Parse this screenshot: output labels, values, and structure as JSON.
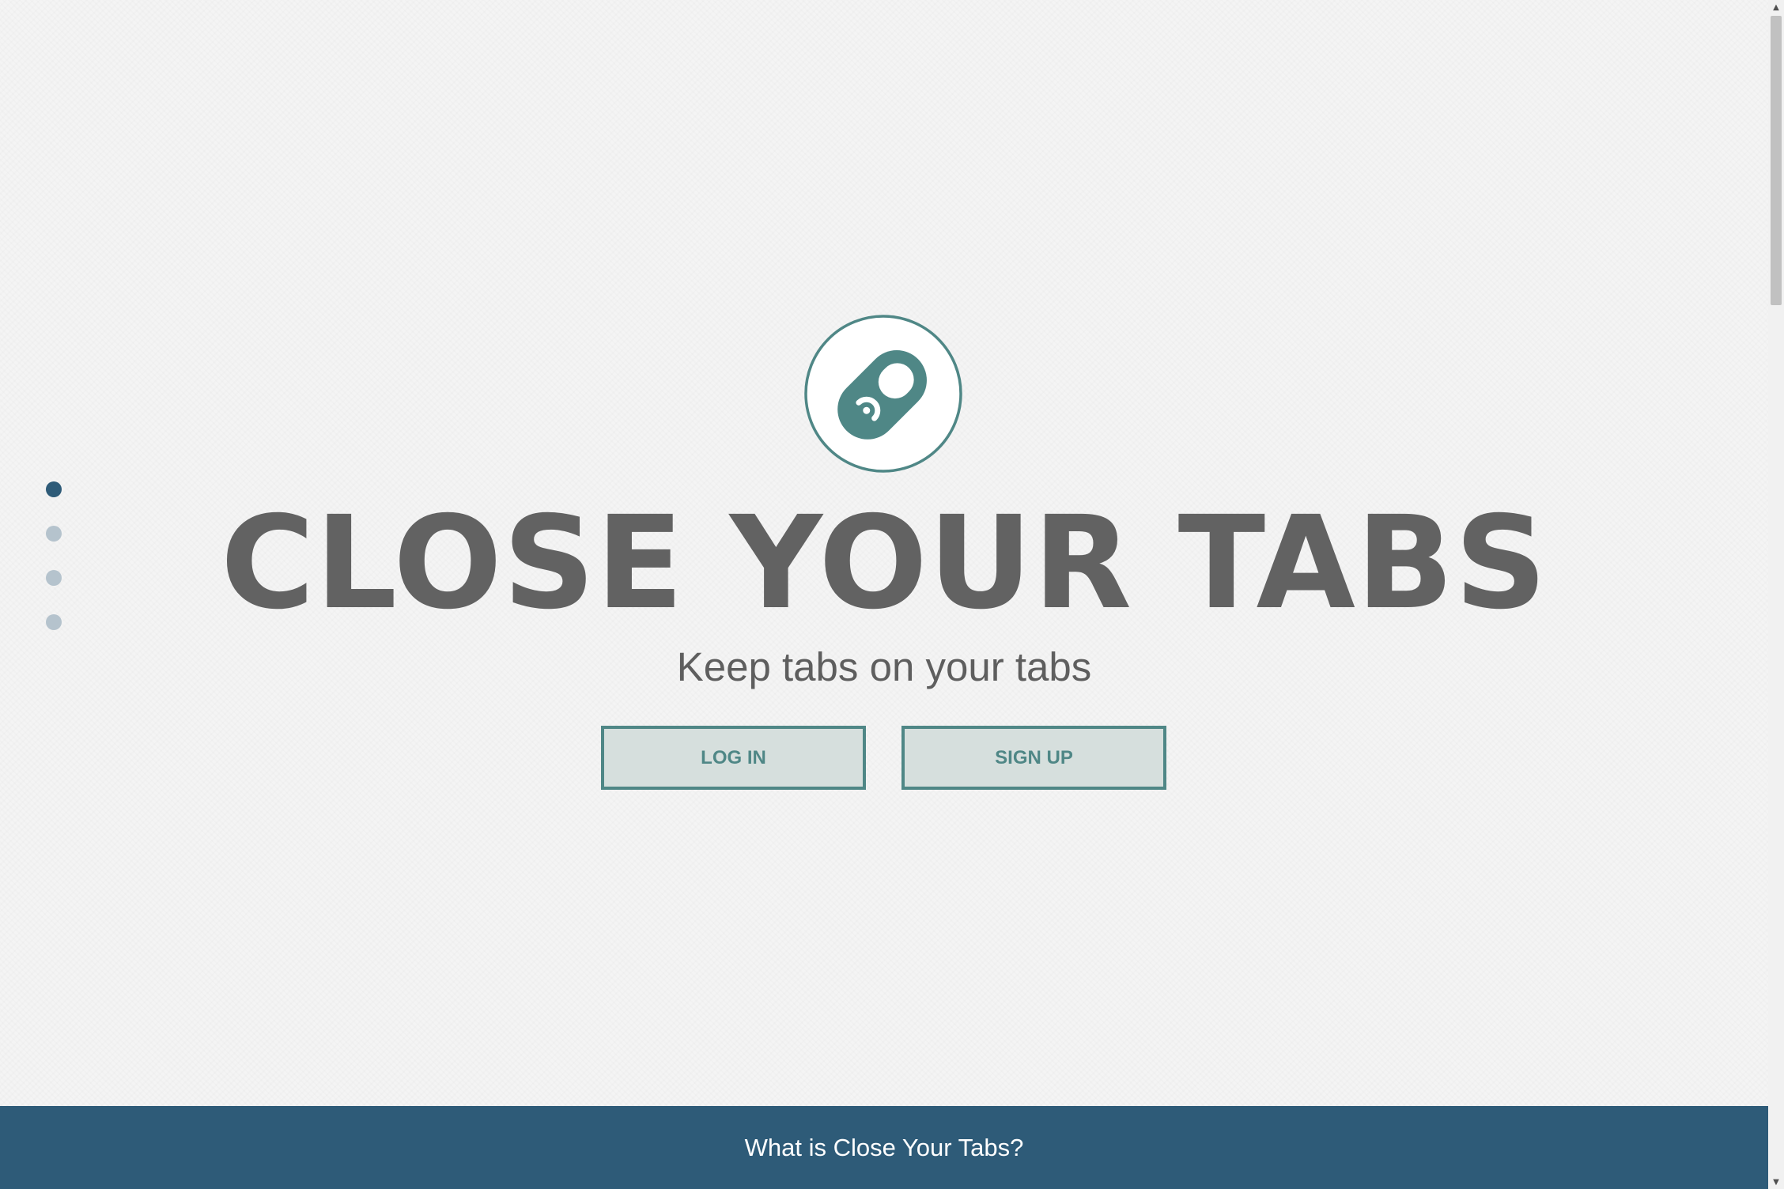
{
  "dot_nav": {
    "items": [
      {
        "label": "section-1",
        "active": true
      },
      {
        "label": "section-2",
        "active": false
      },
      {
        "label": "section-3",
        "active": false
      },
      {
        "label": "section-4",
        "active": false
      }
    ]
  },
  "hero": {
    "logo_icon": "can-pull-tab-icon",
    "title": "CLOSE YOUR TABS",
    "subtitle": "Keep tabs on your tabs",
    "login_label": "LOG IN",
    "signup_label": "SIGN UP"
  },
  "section": {
    "title": "What is Close Your Tabs?"
  },
  "colors": {
    "accent_teal": "#4f8786",
    "brand_navy": "#2e5b78",
    "title_gray": "#626262",
    "dot_inactive": "#b5c3cd",
    "button_fill": "#d6dfdd"
  }
}
